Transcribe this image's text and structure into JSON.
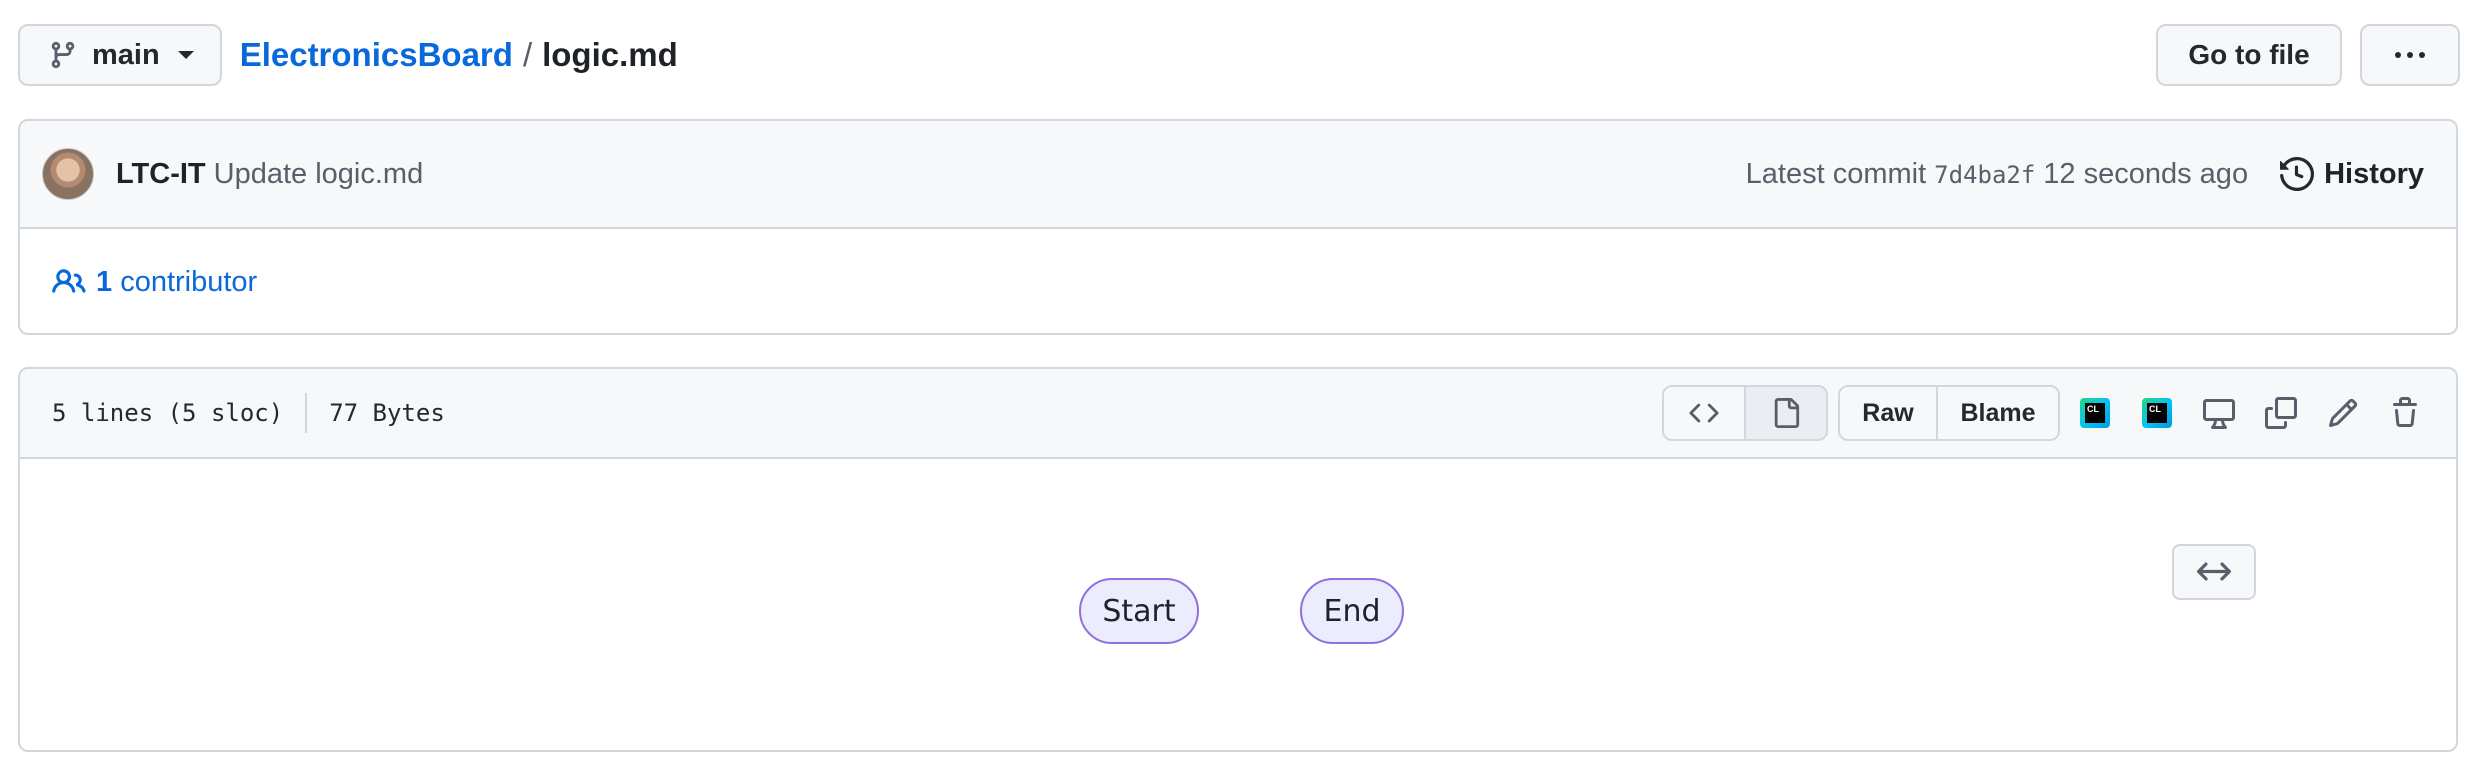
{
  "topbar": {
    "branch": "main",
    "repo": "ElectronicsBoard",
    "separator": "/",
    "file": "logic.md",
    "goto_label": "Go to file"
  },
  "commit": {
    "author": "LTC-IT",
    "message": "Update logic.md",
    "latest_label": "Latest commit",
    "sha": "7d4ba2f",
    "time": "12 seconds ago",
    "history_label": "History"
  },
  "contributors": {
    "count": "1",
    "label": "contributor"
  },
  "file": {
    "lines": "5 lines (5 sloc)",
    "size": "77 Bytes",
    "raw_label": "Raw",
    "blame_label": "Blame",
    "ide_badge_text": "CL"
  },
  "diagram": {
    "nodes": [
      "Start",
      "End"
    ]
  },
  "colors": {
    "link": "#0969da",
    "border": "#d0d7de",
    "header_bg": "#f6f8fa",
    "node_fill": "#ececff",
    "node_stroke": "#9370db"
  }
}
